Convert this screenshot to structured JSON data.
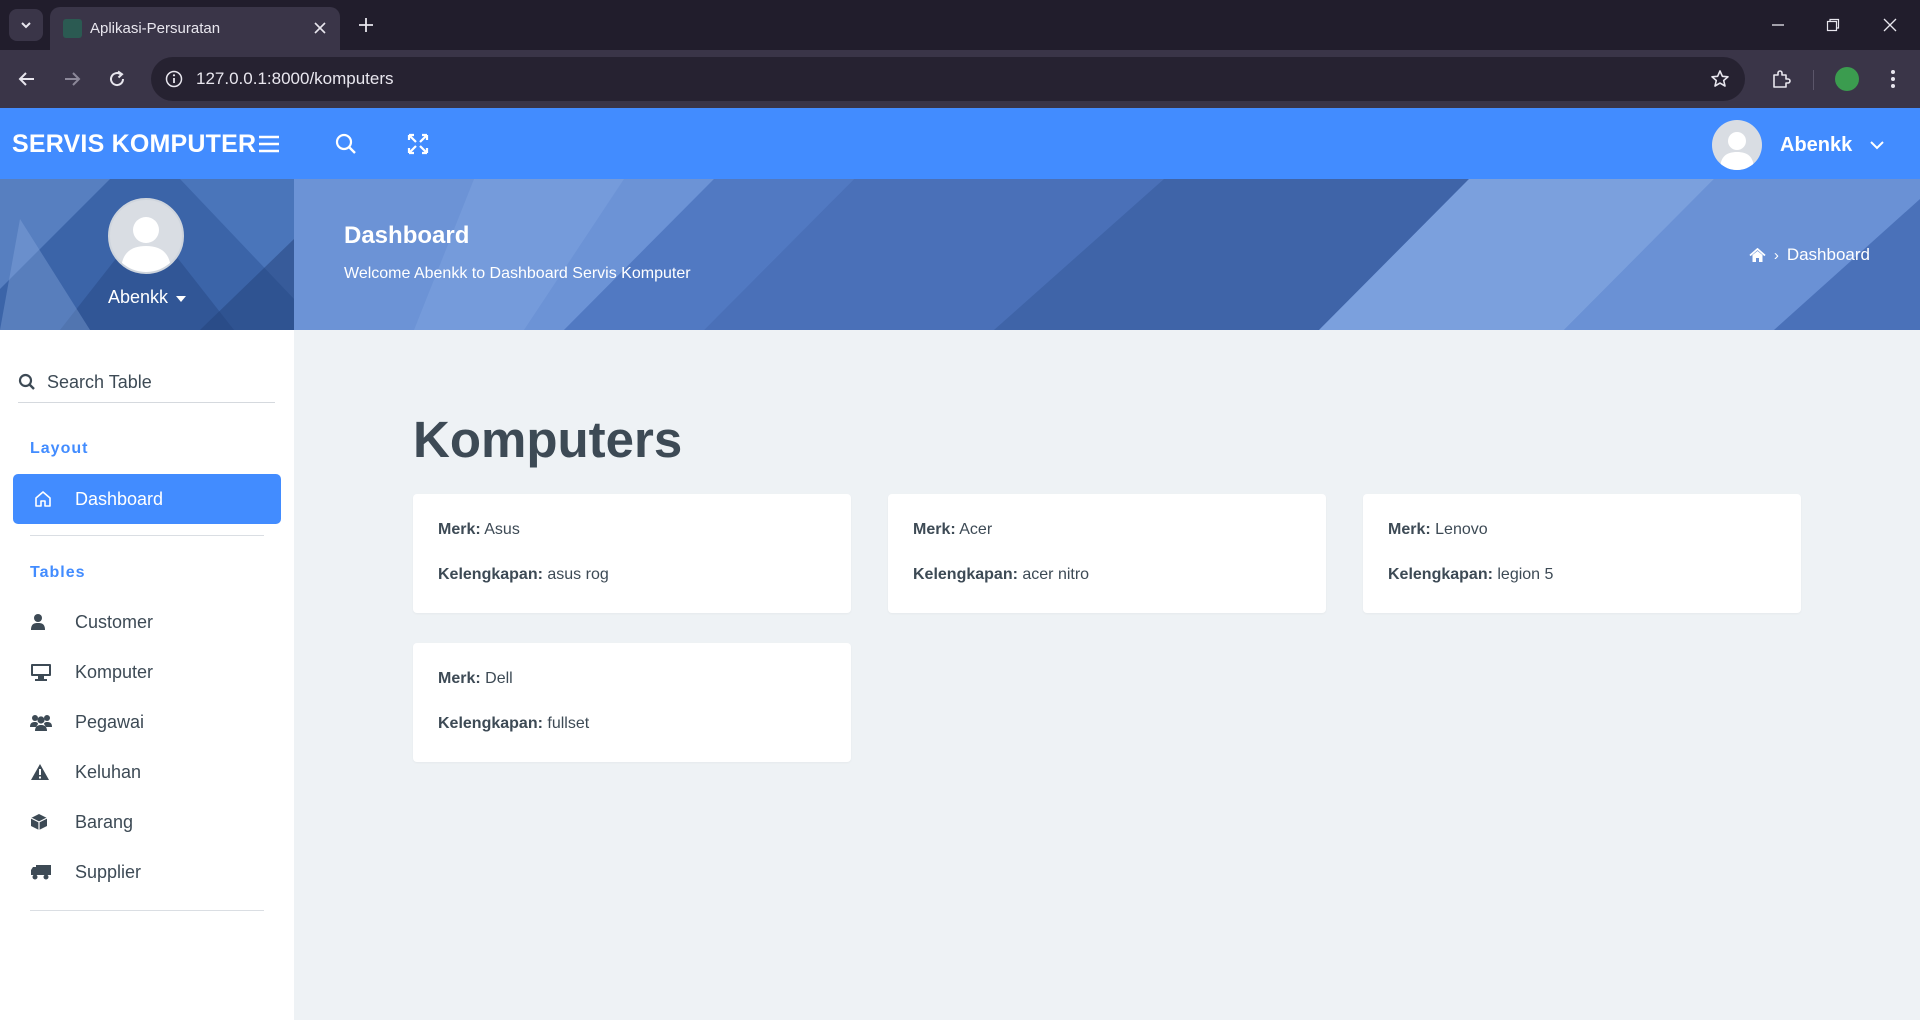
{
  "browser": {
    "tab_title": "Aplikasi-Persuratan",
    "url": "127.0.0.1:8000/komputers"
  },
  "header": {
    "brand": "SERVIS KOMPUTER",
    "user_name": "Abenkk"
  },
  "sidebar": {
    "user_name": "Abenkk",
    "search_placeholder": "Search Table",
    "layout_heading": "Layout",
    "active_item": "Dashboard",
    "tables_heading": "Tables",
    "items": [
      {
        "label": "Customer",
        "icon": "user-icon"
      },
      {
        "label": "Komputer",
        "icon": "desktop-icon"
      },
      {
        "label": "Pegawai",
        "icon": "users-icon"
      },
      {
        "label": "Keluhan",
        "icon": "warning-icon"
      },
      {
        "label": "Barang",
        "icon": "box-icon"
      },
      {
        "label": "Supplier",
        "icon": "truck-icon"
      }
    ]
  },
  "banner": {
    "title": "Dashboard",
    "subtitle": "Welcome Abenkk to Dashboard Servis Komputer",
    "breadcrumb": "Dashboard",
    "breadcrumb_sep": "›"
  },
  "main": {
    "heading": "Komputers",
    "merk_label": "Merk:",
    "kelengkapan_label": "Kelengkapan:",
    "cards": [
      {
        "merk": "Asus",
        "kelengkapan": "asus rog"
      },
      {
        "merk": "Acer",
        "kelengkapan": "acer nitro"
      },
      {
        "merk": "Lenovo",
        "kelengkapan": "legion 5"
      },
      {
        "merk": "Dell",
        "kelengkapan": "fullset"
      }
    ]
  },
  "colors": {
    "accent": "#428cff",
    "banner": "#5c85cc",
    "text": "#3d4a55",
    "background": "#eef2f5"
  }
}
